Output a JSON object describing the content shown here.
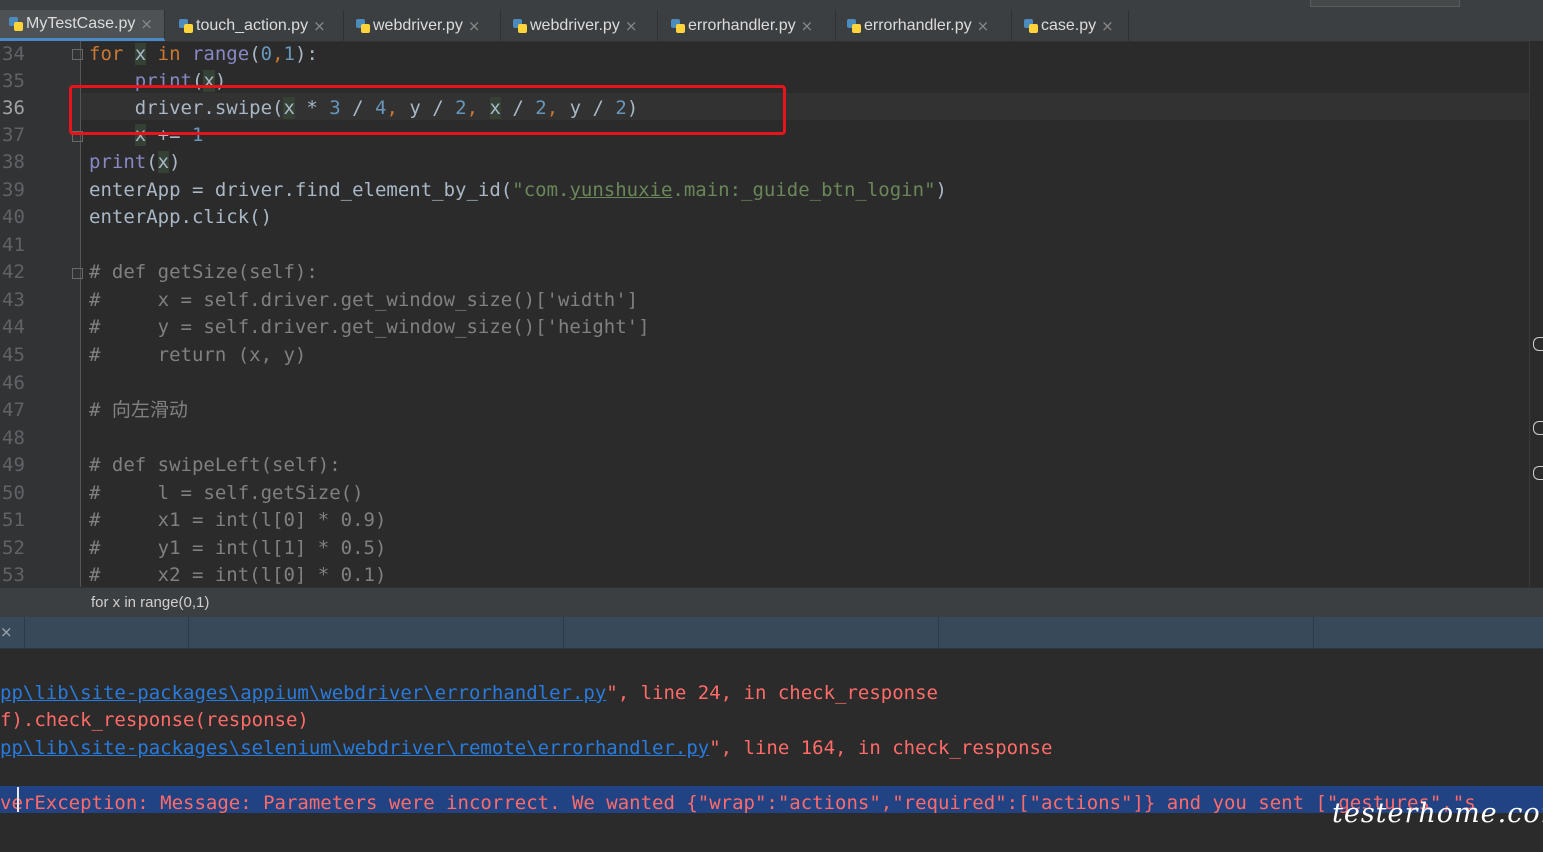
{
  "tabs": [
    {
      "label": "MyTestCase.py",
      "active": true
    },
    {
      "label": "touch_action.py",
      "active": false
    },
    {
      "label": "webdriver.py",
      "active": false
    },
    {
      "label": "webdriver.py",
      "active": false
    },
    {
      "label": "errorhandler.py",
      "active": false
    },
    {
      "label": "errorhandler.py",
      "active": false
    },
    {
      "label": "case.py",
      "active": false
    }
  ],
  "editor": {
    "line_numbers": [
      "34",
      "35",
      "36",
      "37",
      "38",
      "39",
      "40",
      "41",
      "42",
      "43",
      "44",
      "45",
      "46",
      "47",
      "48",
      "49",
      "50",
      "51",
      "52",
      "53"
    ],
    "current_line": "36",
    "lines": [
      {
        "p1": "for ",
        "p2": "x",
        "p3": " in ",
        "p4": "range",
        "p5": "(",
        "p6": "0",
        "p7": ",",
        "p8": "1",
        "p9": "):"
      },
      {
        "indent": "    ",
        "fn": "print",
        "open": "(",
        "var": "x",
        "close": ")"
      },
      {
        "indent": "    ",
        "a": "driver.swipe(",
        "v1": "x",
        "b": " * ",
        "n1": "3",
        "c": " / ",
        "n2": "4",
        "d": ", ",
        "v2": "y",
        "e": " / ",
        "n3": "2",
        "f": ", ",
        "v3": "x",
        "g": " / ",
        "n4": "2",
        "h": ", ",
        "v4": "y",
        "i": " / ",
        "n5": "2",
        "j": ")"
      },
      {
        "indent": "    ",
        "var": "x",
        "rest": " += ",
        "num": "1"
      },
      {
        "fn": "print",
        "open": "(",
        "var": "x",
        "close": ")"
      },
      {
        "a": "enterApp = driver.find_element_by_id(",
        "s1": "\"com.",
        "s2": "yunshuxie",
        "s3": ".main:_guide_btn_login\"",
        "b": ")"
      },
      {
        "text": "enterApp.click()"
      },
      {
        "text": ""
      },
      {
        "text": "# def getSize(self):"
      },
      {
        "text": "#     x = self.driver.get_window_size()['width']"
      },
      {
        "text": "#     y = self.driver.get_window_size()['height']"
      },
      {
        "text": "#     return (x, y)"
      },
      {
        "text": ""
      },
      {
        "text": "# 向左滑动"
      },
      {
        "text": ""
      },
      {
        "text": "# def swipeLeft(self):"
      },
      {
        "text": "#     l = self.getSize()"
      },
      {
        "text": "#     x1 = int(l[0] * 0.9)"
      },
      {
        "text": "#     y1 = int(l[1] * 0.5)"
      },
      {
        "text": "#     x2 = int(l[0] * 0.1)"
      }
    ]
  },
  "breadcrumb": "for x in range(0,1)",
  "run_panel": {
    "close_label": "×"
  },
  "console": [
    {
      "link": "pp\\lib\\site-packages\\appium\\webdriver\\errorhandler.py",
      "rest": "\", line 24, in check_response"
    },
    {
      "text": "f).check_response(response)"
    },
    {
      "link": "pp\\lib\\site-packages\\selenium\\webdriver\\remote\\errorhandler.py",
      "rest": "\", line 164, in check_response"
    },
    {
      "text": ""
    },
    {
      "text": "verException: Message: Parameters were incorrect. We wanted {\"wrap\":\"actions\",\"required\":[\"actions\"]} and you sent [\"gestures\",\"s"
    }
  ],
  "watermark": "testerhome.com",
  "colors": {
    "highlight_box": "#e8141b",
    "accent_tab": "#4a88c7"
  }
}
